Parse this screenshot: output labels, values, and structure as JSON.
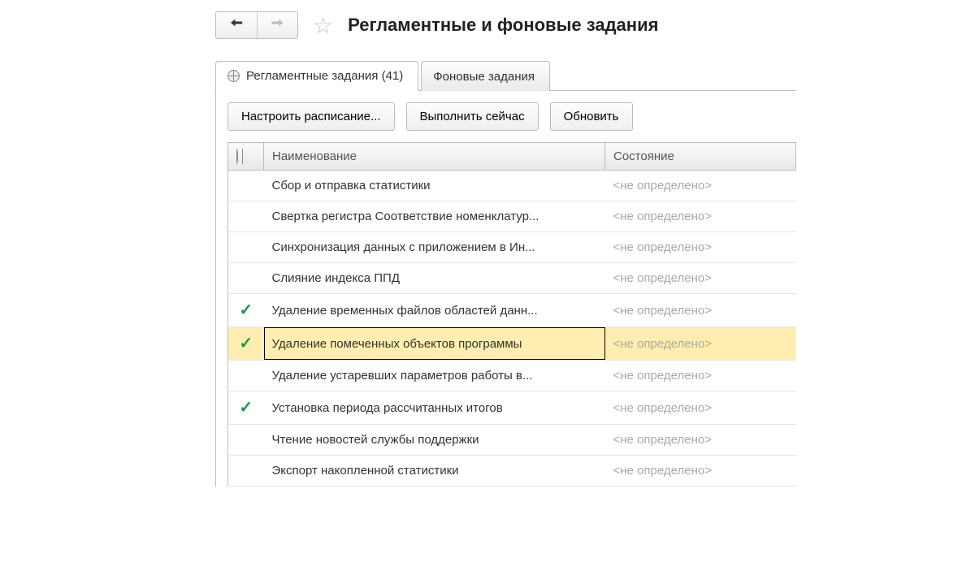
{
  "header": {
    "title": "Регламентные и фоновые задания"
  },
  "tabs": {
    "scheduled": "Регламентные задания (41)",
    "background": "Фоновые задания"
  },
  "toolbar": {
    "schedule": "Настроить расписание...",
    "run_now": "Выполнить сейчас",
    "refresh": "Обновить"
  },
  "table": {
    "header_name": "Наименование",
    "header_state": "Состояние",
    "state_unset": "<не определено>",
    "rows": [
      {
        "check": false,
        "name": "Сбор и отправка статистики"
      },
      {
        "check": false,
        "name": "Свертка регистра Соответствие номенклатур..."
      },
      {
        "check": false,
        "name": "Синхронизация данных с приложением в Ин..."
      },
      {
        "check": false,
        "name": "Слияние индекса ППД"
      },
      {
        "check": true,
        "name": "Удаление временных файлов областей данн..."
      },
      {
        "check": true,
        "name": "Удаление помеченных объектов программы",
        "selected": true
      },
      {
        "check": false,
        "name": "Удаление устаревших параметров работы в..."
      },
      {
        "check": true,
        "name": "Установка периода рассчитанных итогов"
      },
      {
        "check": false,
        "name": "Чтение новостей службы поддержки"
      },
      {
        "check": false,
        "name": "Экспорт накопленной статистики"
      }
    ]
  }
}
